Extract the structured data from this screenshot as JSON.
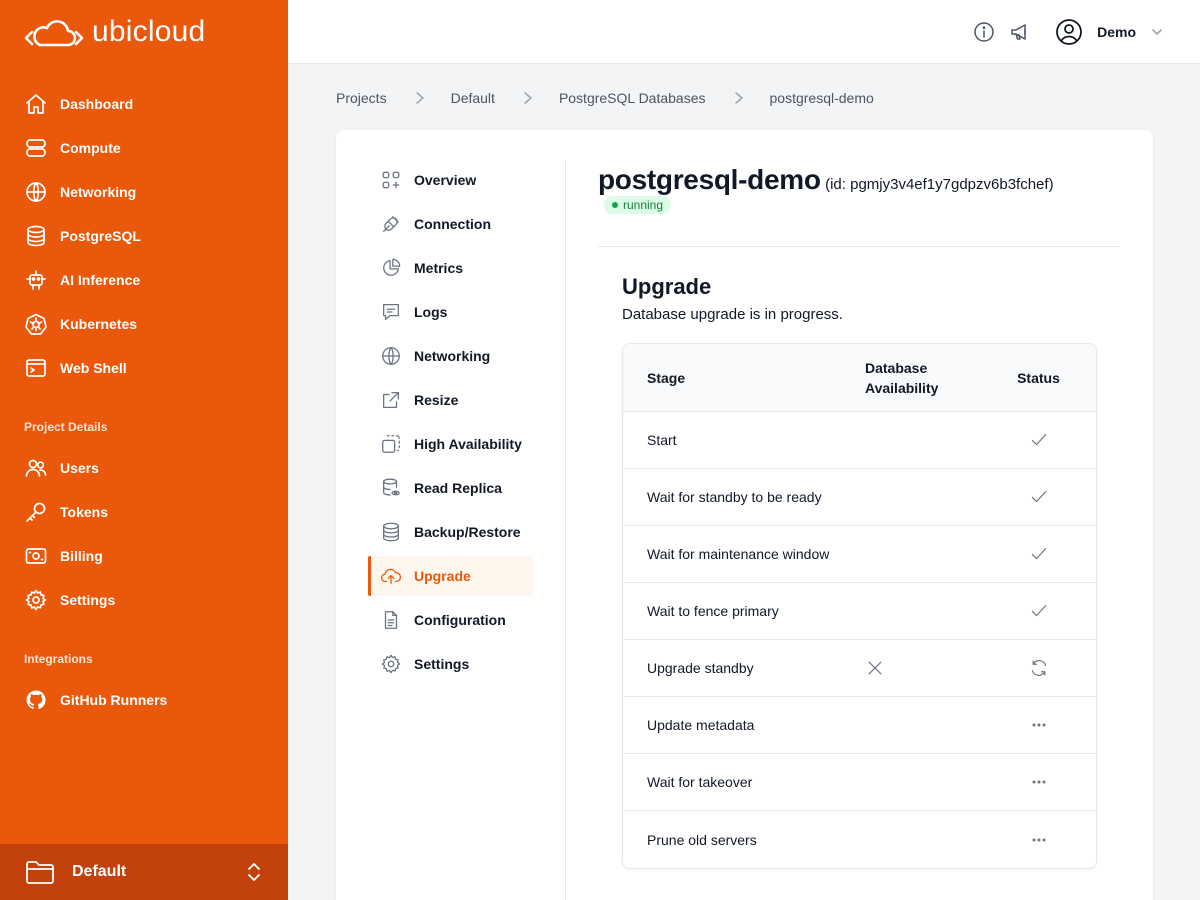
{
  "brand": {
    "name": "ubicloud"
  },
  "sidebar": {
    "items": [
      {
        "label": "Dashboard",
        "icon": "home-icon"
      },
      {
        "label": "Compute",
        "icon": "server-icon"
      },
      {
        "label": "Networking",
        "icon": "globe-icon"
      },
      {
        "label": "PostgreSQL",
        "icon": "database-icon"
      },
      {
        "label": "AI Inference",
        "icon": "robot-icon"
      },
      {
        "label": "Kubernetes",
        "icon": "kubernetes-icon"
      },
      {
        "label": "Web Shell",
        "icon": "terminal-icon"
      }
    ],
    "project_section": "Project Details",
    "project_items": [
      {
        "label": "Users",
        "icon": "users-icon"
      },
      {
        "label": "Tokens",
        "icon": "key-icon"
      },
      {
        "label": "Billing",
        "icon": "banknote-icon"
      },
      {
        "label": "Settings",
        "icon": "gear-icon"
      }
    ],
    "integrations_section": "Integrations",
    "integration_items": [
      {
        "label": "GitHub Runners",
        "icon": "github-icon"
      }
    ],
    "footer": {
      "project": "Default"
    }
  },
  "topbar": {
    "user": "Demo"
  },
  "breadcrumb": [
    "Projects",
    "Default",
    "PostgreSQL Databases",
    "postgresql-demo"
  ],
  "subnav": {
    "items": [
      "Overview",
      "Connection",
      "Metrics",
      "Logs",
      "Networking",
      "Resize",
      "High Availability",
      "Read Replica",
      "Backup/Restore",
      "Upgrade",
      "Configuration",
      "Settings"
    ],
    "active": "Upgrade"
  },
  "database": {
    "name": "postgresql-demo",
    "id_text": "(id: pgmjy3v4ef1y7gdpzv6b3fchef)",
    "status": "running"
  },
  "upgrade": {
    "title": "Upgrade",
    "subtitle": "Database upgrade is in progress.",
    "columns": {
      "stage": "Stage",
      "availability": "Database Availability",
      "status": "Status"
    },
    "rows": [
      {
        "stage": "Start",
        "availability": "",
        "status": "done"
      },
      {
        "stage": "Wait for standby to be ready",
        "availability": "",
        "status": "done"
      },
      {
        "stage": "Wait for maintenance window",
        "availability": "",
        "status": "done"
      },
      {
        "stage": "Wait to fence primary",
        "availability": "",
        "status": "done"
      },
      {
        "stage": "Upgrade standby",
        "availability": "unavailable",
        "status": "in-progress"
      },
      {
        "stage": "Update metadata",
        "availability": "",
        "status": "pending"
      },
      {
        "stage": "Wait for takeover",
        "availability": "",
        "status": "pending"
      },
      {
        "stage": "Prune old servers",
        "availability": "",
        "status": "pending"
      }
    ]
  },
  "colors": {
    "brand": "#ea580c",
    "footer": "#c2410c",
    "running": "#15803d"
  }
}
